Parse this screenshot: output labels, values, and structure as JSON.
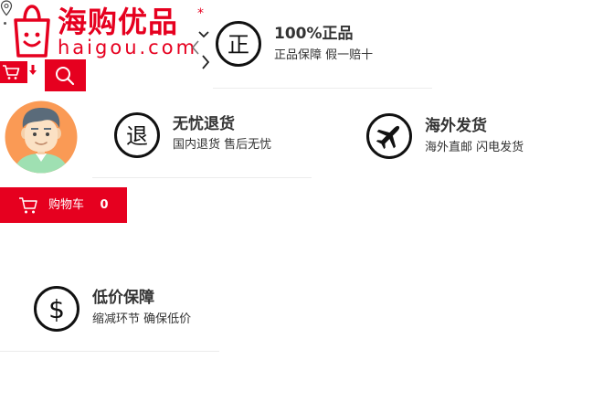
{
  "header": {
    "logo_cn": "海购优品",
    "logo_en": "haigou.com",
    "logo_star": "*"
  },
  "cart": {
    "label": "购物车",
    "count": "0"
  },
  "features": [
    {
      "icon": "zheng-icon",
      "title": "100%正品",
      "desc": "正品保障  假一赔十"
    },
    {
      "icon": "return-icon",
      "title": "无忧退货",
      "desc": "国内退货  售后无忧"
    },
    {
      "icon": "airplane-icon",
      "title": "海外发货",
      "desc": "海外直邮  闪电发货"
    },
    {
      "icon": "dollar-icon",
      "title": "低价保障",
      "desc": "缩减环节  确保低价"
    }
  ],
  "colors": {
    "brand_red": "#e6001f",
    "text": "#333333"
  }
}
